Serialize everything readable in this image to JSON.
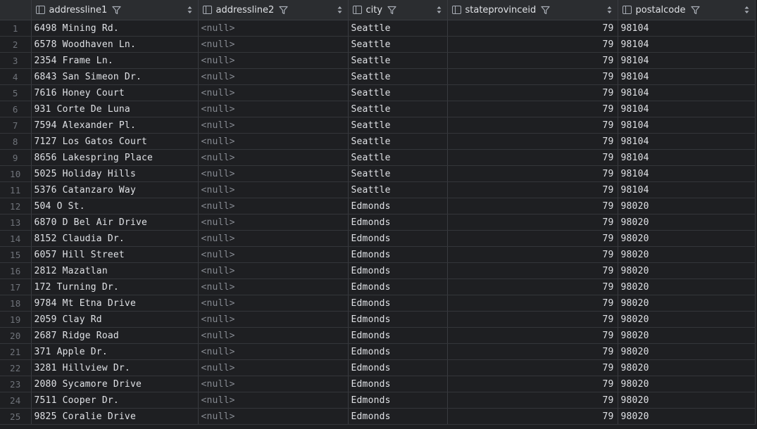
{
  "columns": {
    "addressline1": "addressline1",
    "addressline2": "addressline2",
    "city": "city",
    "stateprovinceid": "stateprovinceid",
    "postalcode": "postalcode"
  },
  "rows": [
    {
      "n": "1",
      "addressline1": "6498 Mining Rd.",
      "addressline2": "<null>",
      "city": "Seattle",
      "stateprovinceid": "79",
      "postalcode": "98104"
    },
    {
      "n": "2",
      "addressline1": "6578 Woodhaven Ln.",
      "addressline2": "<null>",
      "city": "Seattle",
      "stateprovinceid": "79",
      "postalcode": "98104"
    },
    {
      "n": "3",
      "addressline1": "2354 Frame Ln.",
      "addressline2": "<null>",
      "city": "Seattle",
      "stateprovinceid": "79",
      "postalcode": "98104"
    },
    {
      "n": "4",
      "addressline1": "6843 San Simeon Dr.",
      "addressline2": "<null>",
      "city": "Seattle",
      "stateprovinceid": "79",
      "postalcode": "98104"
    },
    {
      "n": "5",
      "addressline1": "7616 Honey Court",
      "addressline2": "<null>",
      "city": "Seattle",
      "stateprovinceid": "79",
      "postalcode": "98104"
    },
    {
      "n": "6",
      "addressline1": "931 Corte De Luna",
      "addressline2": "<null>",
      "city": "Seattle",
      "stateprovinceid": "79",
      "postalcode": "98104"
    },
    {
      "n": "7",
      "addressline1": "7594 Alexander Pl.",
      "addressline2": "<null>",
      "city": "Seattle",
      "stateprovinceid": "79",
      "postalcode": "98104"
    },
    {
      "n": "8",
      "addressline1": "7127 Los Gatos Court",
      "addressline2": "<null>",
      "city": "Seattle",
      "stateprovinceid": "79",
      "postalcode": "98104"
    },
    {
      "n": "9",
      "addressline1": "8656 Lakespring Place",
      "addressline2": "<null>",
      "city": "Seattle",
      "stateprovinceid": "79",
      "postalcode": "98104"
    },
    {
      "n": "10",
      "addressline1": "5025 Holiday Hills",
      "addressline2": "<null>",
      "city": "Seattle",
      "stateprovinceid": "79",
      "postalcode": "98104"
    },
    {
      "n": "11",
      "addressline1": "5376 Catanzaro Way",
      "addressline2": "<null>",
      "city": "Seattle",
      "stateprovinceid": "79",
      "postalcode": "98104"
    },
    {
      "n": "12",
      "addressline1": "504 O St.",
      "addressline2": "<null>",
      "city": "Edmonds",
      "stateprovinceid": "79",
      "postalcode": "98020"
    },
    {
      "n": "13",
      "addressline1": "6870 D Bel Air Drive",
      "addressline2": "<null>",
      "city": "Edmonds",
      "stateprovinceid": "79",
      "postalcode": "98020"
    },
    {
      "n": "14",
      "addressline1": "8152 Claudia Dr.",
      "addressline2": "<null>",
      "city": "Edmonds",
      "stateprovinceid": "79",
      "postalcode": "98020"
    },
    {
      "n": "15",
      "addressline1": "6057 Hill Street",
      "addressline2": "<null>",
      "city": "Edmonds",
      "stateprovinceid": "79",
      "postalcode": "98020"
    },
    {
      "n": "16",
      "addressline1": "2812 Mazatlan",
      "addressline2": "<null>",
      "city": "Edmonds",
      "stateprovinceid": "79",
      "postalcode": "98020"
    },
    {
      "n": "17",
      "addressline1": "172 Turning Dr.",
      "addressline2": "<null>",
      "city": "Edmonds",
      "stateprovinceid": "79",
      "postalcode": "98020"
    },
    {
      "n": "18",
      "addressline1": "9784 Mt Etna Drive",
      "addressline2": "<null>",
      "city": "Edmonds",
      "stateprovinceid": "79",
      "postalcode": "98020"
    },
    {
      "n": "19",
      "addressline1": "2059 Clay Rd",
      "addressline2": "<null>",
      "city": "Edmonds",
      "stateprovinceid": "79",
      "postalcode": "98020"
    },
    {
      "n": "20",
      "addressline1": "2687 Ridge Road",
      "addressline2": "<null>",
      "city": "Edmonds",
      "stateprovinceid": "79",
      "postalcode": "98020"
    },
    {
      "n": "21",
      "addressline1": "371 Apple Dr.",
      "addressline2": "<null>",
      "city": "Edmonds",
      "stateprovinceid": "79",
      "postalcode": "98020"
    },
    {
      "n": "22",
      "addressline1": "3281 Hillview Dr.",
      "addressline2": "<null>",
      "city": "Edmonds",
      "stateprovinceid": "79",
      "postalcode": "98020"
    },
    {
      "n": "23",
      "addressline1": "2080 Sycamore Drive",
      "addressline2": "<null>",
      "city": "Edmonds",
      "stateprovinceid": "79",
      "postalcode": "98020"
    },
    {
      "n": "24",
      "addressline1": "7511 Cooper Dr.",
      "addressline2": "<null>",
      "city": "Edmonds",
      "stateprovinceid": "79",
      "postalcode": "98020"
    },
    {
      "n": "25",
      "addressline1": "9825 Coralie Drive",
      "addressline2": "<null>",
      "city": "Edmonds",
      "stateprovinceid": "79",
      "postalcode": "98020"
    }
  ],
  "icons": {
    "column": "column-icon",
    "filter": "filter-icon",
    "sort": "sort-icon"
  },
  "colors": {
    "background": "#1e1f22",
    "header": "#2b2d30",
    "text": "#dfe1e5",
    "null_text": "#868a91",
    "row_number": "#6f737a"
  }
}
